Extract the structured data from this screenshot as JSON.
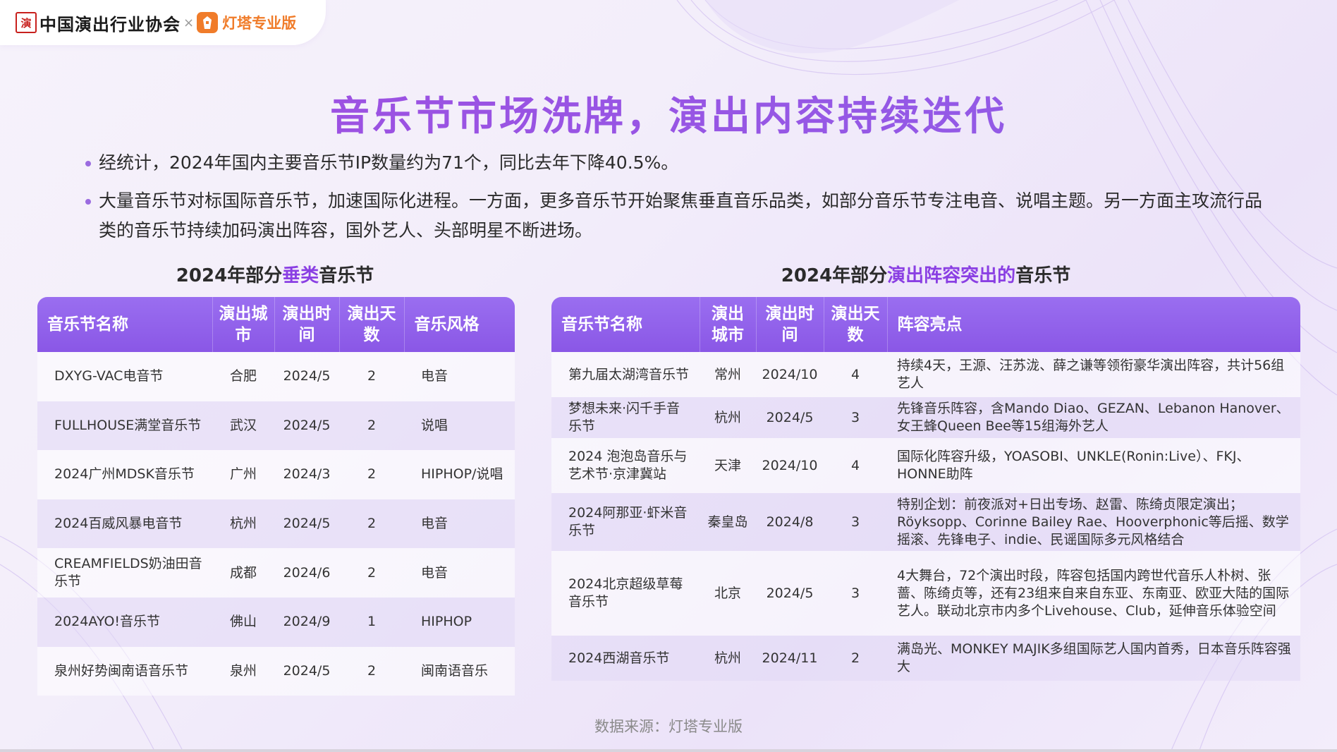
{
  "header": {
    "assoc_seal": "演",
    "assoc_name": "中国演出行业协会",
    "cross": "×",
    "partner_name": "灯塔专业版"
  },
  "title": "音乐节市场洗牌，演出内容持续迭代",
  "bullets": [
    "经统计，2024年国内主要音乐节IP数量约为71个，同比去年下降40.5%。",
    "大量音乐节对标国际音乐节，加速国际化进程。一方面，更多音乐节开始聚焦垂直音乐品类，如部分音乐节专注电音、说唱主题。另一方面主攻流行品类的音乐节持续加码演出阵容，国外艺人、头部明星不断进场。"
  ],
  "left_table": {
    "subtitle_pre": "2024年部分",
    "subtitle_hl": "垂类",
    "subtitle_post": "音乐节",
    "headers": [
      "音乐节名称",
      "演出城市",
      "演出时间",
      "演出天数",
      "音乐风格"
    ],
    "rows": [
      [
        "DXYG-VAC电音节",
        "合肥",
        "2024/5",
        "2",
        "电音"
      ],
      [
        "FULLHOUSE满堂音乐节",
        "武汉",
        "2024/5",
        "2",
        "说唱"
      ],
      [
        "2024广州MDSK音乐节",
        "广州",
        "2024/3",
        "2",
        "HIPHOP/说唱"
      ],
      [
        "2024百威风暴电音节",
        "杭州",
        "2024/5",
        "2",
        "电音"
      ],
      [
        "CREAMFIELDS奶油田音乐节",
        "成都",
        "2024/6",
        "2",
        "电音"
      ],
      [
        "2024AYO!音乐节",
        "佛山",
        "2024/9",
        "1",
        "HIPHOP"
      ],
      [
        "泉州好势闽南语音乐节",
        "泉州",
        "2024/5",
        "2",
        "闽南语音乐"
      ]
    ]
  },
  "right_table": {
    "subtitle_pre": "2024年部分",
    "subtitle_hl": "演出阵容突出的",
    "subtitle_post": "音乐节",
    "headers": [
      "音乐节名称",
      "演出城市",
      "演出时间",
      "演出天数",
      "阵容亮点"
    ],
    "rows": [
      [
        "第九届太湖湾音乐节",
        "常州",
        "2024/10",
        "4",
        "持续4天，王源、汪苏泷、薛之谦等领衔豪华演出阵容，共计56组艺人"
      ],
      [
        "梦想未来·闪千手音乐节",
        "杭州",
        "2024/5",
        "3",
        "先锋音乐阵容，含Mando Diao、GEZAN、Lebanon Hanover、女王蜂Queen Bee等15组海外艺人"
      ],
      [
        "2024 泡泡岛音乐与艺术节·京津冀站",
        "天津",
        "2024/10",
        "4",
        "国际化阵容升级，YOASOBI、UNKLE(Ronin:Live）、FKJ、HONNE助阵"
      ],
      [
        "2024阿那亚·虾米音乐节",
        "秦皇岛",
        "2024/8",
        "3",
        "特别企划：前夜派对+日出专场、赵雷、陈绮贞限定演出；Röyksopp、Corinne Bailey Rae、Hooverphonic等后摇、数学摇滚、先锋电子、indie、民谣国际多元风格结合"
      ],
      [
        "2024北京超级草莓音乐节",
        "北京",
        "2024/5",
        "3",
        "4大舞台，72个演出时段，阵容包括国内跨世代音乐人朴树、张蔷、陈绮贞等，还有23组来自来自东亚、东南亚、欧亚大陆的国际艺人。联动北京市内多个Livehouse、Club，延伸音乐体验空间"
      ],
      [
        "2024西湖音乐节",
        "杭州",
        "2024/11",
        "2",
        "满岛光、MONKEY MAJIK多组国际艺人国内首秀，日本音乐阵容强大"
      ]
    ]
  },
  "source": "数据来源：灯塔专业版",
  "colors": {
    "title": "#9a52e0",
    "header_bg": "#8a57e6",
    "highlight": "#8a3fe3",
    "partner": "#f07c2a",
    "seal": "#c8201d"
  }
}
